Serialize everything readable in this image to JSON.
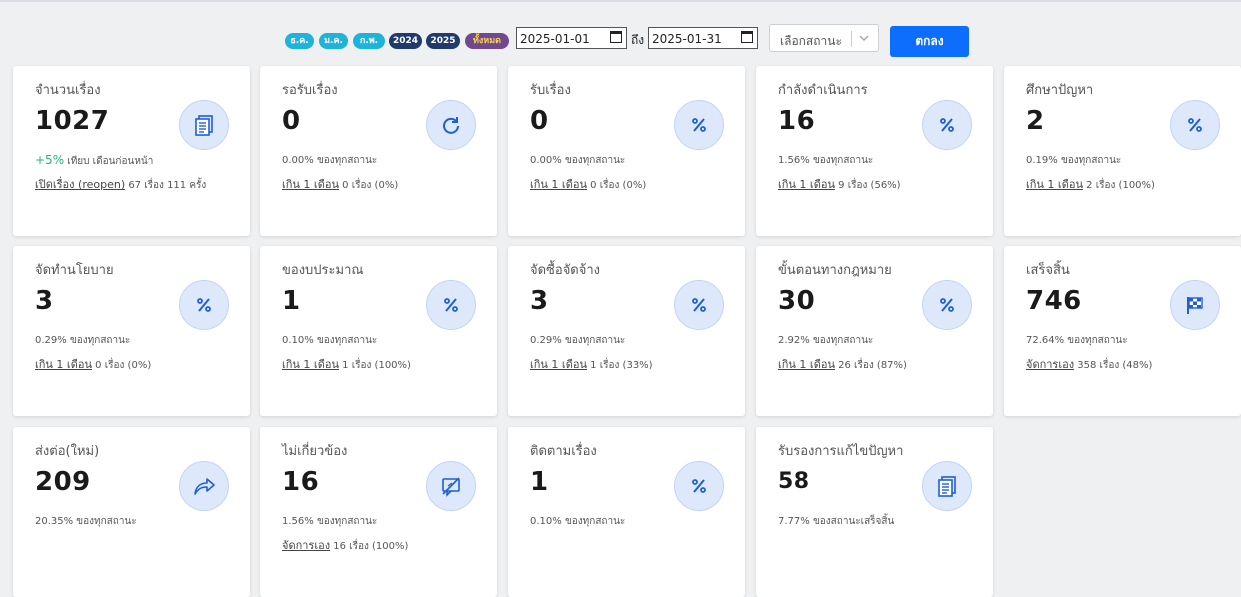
{
  "filters": {
    "pills": [
      {
        "label": "ธ.ค.",
        "style": "cyan"
      },
      {
        "label": "ม.ค.",
        "style": "cyan"
      },
      {
        "label": "ก.พ.",
        "style": "cyan"
      },
      {
        "label": "2024",
        "style": "navy"
      },
      {
        "label": "2025",
        "style": "navy"
      },
      {
        "label": "ทั้งหมด",
        "style": "purple"
      }
    ],
    "start_date": "2025-01-01",
    "to_label": "ถึง",
    "end_date": "2025-01-31",
    "status_placeholder": "เลือกสถานะ",
    "ok_label": "ตกลง"
  },
  "colors": {
    "accent": "#0d6efd",
    "positive": "#2ab27b",
    "icon": "#1f5fd6",
    "icon_bg": "#dde8fb"
  },
  "cards": [
    {
      "title": "จำนวนเรื่อง",
      "value": "1027",
      "icon": "documents-icon",
      "delta": "+5%",
      "pct_text": "เทียบ เดือนก่อนหน้า",
      "link": "เปิดเรื่อง (reopen)",
      "extra": "67 เรื่อง 111 ครั้ง"
    },
    {
      "title": "รอรับเรื่อง",
      "value": "0",
      "icon": "refresh-icon",
      "pct_text": "0.00% ของทุกสถานะ",
      "link": "เกิน 1 เดือน",
      "extra": "0 เรื่อง (0%)"
    },
    {
      "title": "รับเรื่อง",
      "value": "0",
      "icon": "percent-icon",
      "pct_text": "0.00% ของทุกสถานะ",
      "link": "เกิน 1 เดือน",
      "extra": "0 เรื่อง (0%)"
    },
    {
      "title": "กำลังดำเนินการ",
      "value": "16",
      "icon": "percent-icon",
      "pct_text": "1.56% ของทุกสถานะ",
      "link": "เกิน 1 เดือน",
      "extra": "9 เรื่อง (56%)"
    },
    {
      "title": "ศึกษาปัญหา",
      "value": "2",
      "icon": "percent-icon",
      "pct_text": "0.19% ของทุกสถานะ",
      "link": "เกิน 1 เดือน",
      "extra": "2 เรื่อง (100%)"
    },
    {
      "title": "จัดทำนโยบาย",
      "value": "3",
      "icon": "percent-icon",
      "pct_text": "0.29% ของทุกสถานะ",
      "link": "เกิน 1 เดือน",
      "extra": "0 เรื่อง (0%)"
    },
    {
      "title": "ของบประมาณ",
      "value": "1",
      "icon": "percent-icon",
      "pct_text": "0.10% ของทุกสถานะ",
      "link": "เกิน 1 เดือน",
      "extra": "1 เรื่อง (100%)"
    },
    {
      "title": "จัดซื้อจัดจ้าง",
      "value": "3",
      "icon": "percent-icon",
      "pct_text": "0.29% ของทุกสถานะ",
      "link": "เกิน 1 เดือน",
      "extra": "1 เรื่อง (33%)"
    },
    {
      "title": "ขั้นตอนทางกฎหมาย",
      "value": "30",
      "icon": "percent-icon",
      "pct_text": "2.92% ของทุกสถานะ",
      "link": "เกิน 1 เดือน",
      "extra": "26 เรื่อง (87%)"
    },
    {
      "title": "เสร็จสิ้น",
      "value": "746",
      "icon": "checkered-flag-icon",
      "pct_text": "72.64% ของทุกสถานะ",
      "link": "จัดการเอง",
      "extra": "358 เรื่อง (48%)"
    },
    {
      "title": "ส่งต่อ(ใหม่)",
      "value": "209",
      "icon": "share-arrow-icon",
      "pct_text": "20.35% ของทุกสถานะ",
      "link": "",
      "extra": ""
    },
    {
      "title": "ไม่เกี่ยวข้อง",
      "value": "16",
      "icon": "comment-off-icon",
      "pct_text": "1.56% ของทุกสถานะ",
      "link": "จัดการเอง",
      "extra": "16 เรื่อง (100%)"
    },
    {
      "title": "ติดตามเรื่อง",
      "value": "1",
      "icon": "percent-icon",
      "pct_text": "0.10% ของทุกสถานะ",
      "link": "",
      "extra": ""
    },
    {
      "title": "รับรองการแก้ไขปัญหา",
      "value": "58",
      "icon": "documents-icon",
      "pct_text": "7.77% ของสถานะเสร็จสิ้น",
      "link": "",
      "extra": ""
    }
  ]
}
